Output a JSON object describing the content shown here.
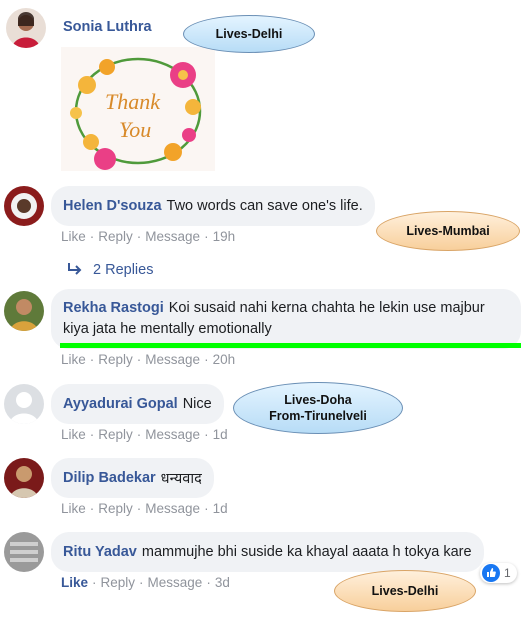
{
  "comments": [
    {
      "author": "Sonia Luthra",
      "image_alt": "Thank You card",
      "image_text_line1": "Thank",
      "image_text_line2": "You"
    },
    {
      "author": "Helen D'souza",
      "text": "Two words can save one's life.",
      "actions": [
        "Like",
        "Reply",
        "Message"
      ],
      "time": "19h",
      "replies": "2 Replies"
    },
    {
      "author": "Rekha Rastogi",
      "text": "Koi susaid nahi kerna chahta he lekin use majbur kiya jata he mentally emotionally",
      "actions": [
        "Like",
        "Reply",
        "Message"
      ],
      "time": "20h"
    },
    {
      "author": "Ayyadurai Gopal",
      "text": "Nice",
      "actions": [
        "Like",
        "Reply",
        "Message"
      ],
      "time": "1d"
    },
    {
      "author": "Dilip Badekar",
      "text": "धन्यवाद",
      "actions": [
        "Like",
        "Reply",
        "Message"
      ],
      "time": "1d"
    },
    {
      "author": "Ritu Yadav",
      "text": "mammujhe bhi suside ka khayal aaata h tokya kare",
      "actions": [
        "Like",
        "Reply",
        "Message"
      ],
      "time": "3d",
      "reaction_count": "1"
    }
  ],
  "callouts": {
    "sonia": "Lives-Delhi",
    "helen": "Lives-Mumbai",
    "ayyadurai_line1": "Lives-Doha",
    "ayyadurai_line2": "From-Tirunelveli",
    "ritu": "Lives-Delhi"
  },
  "colors": {
    "author": "#385898",
    "highlight": "#00ff00",
    "bubble": "#f0f2f5",
    "meta": "#90949c"
  }
}
